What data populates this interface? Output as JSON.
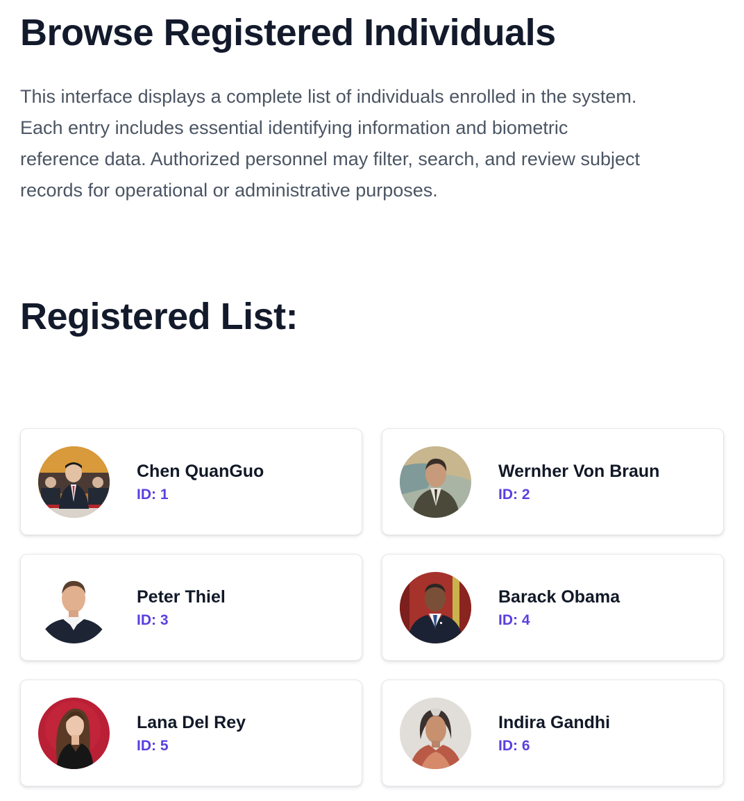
{
  "page": {
    "title": "Browse Registered Individuals",
    "description": "This interface displays a complete list of individuals enrolled in the system. Each entry includes essential identifying information and biometric reference data. Authorized personnel may filter, search, and review subject records for operational or administrative purposes.",
    "list_heading": "Registered List:"
  },
  "theme": {
    "id_color": "#5b3fe0",
    "heading_color": "#131a2b",
    "body_text_color": "#4b5563"
  },
  "people": [
    {
      "name": "Chen QuanGuo",
      "id_label": "ID: 1",
      "photo": "portrait-photo"
    },
    {
      "name": "Wernher Von Braun",
      "id_label": "ID: 2",
      "photo": "portrait-photo"
    },
    {
      "name": "Peter Thiel",
      "id_label": "ID: 3",
      "photo": "portrait-photo"
    },
    {
      "name": "Barack Obama",
      "id_label": "ID: 4",
      "photo": "portrait-photo"
    },
    {
      "name": "Lana Del Rey",
      "id_label": "ID: 5",
      "photo": "portrait-photo"
    },
    {
      "name": "Indira Gandhi",
      "id_label": "ID: 6",
      "photo": "portrait-photo"
    }
  ]
}
